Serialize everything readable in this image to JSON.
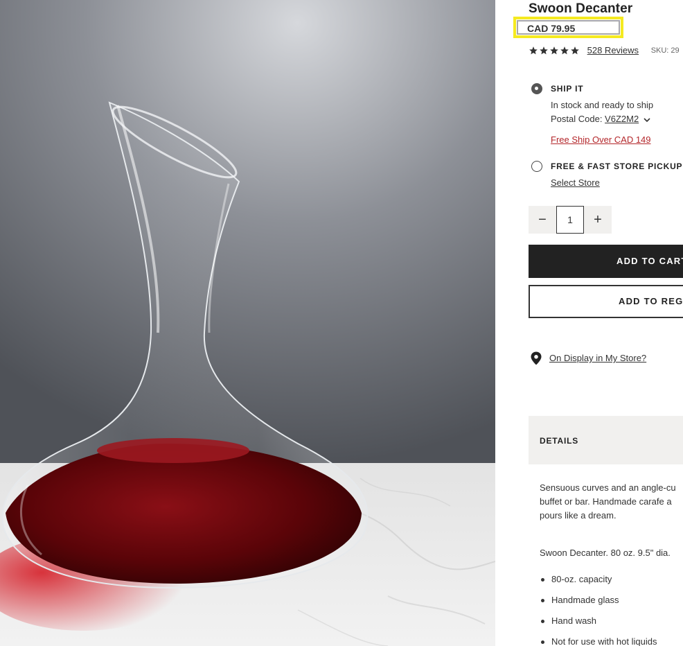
{
  "product": {
    "title": "Swoon Decanter",
    "price": "CAD 79.95",
    "rating_stars": 5,
    "reviews_link": "528 Reviews",
    "sku_label": "SKU: 29"
  },
  "fulfillment": {
    "ship_label": "SHIP IT",
    "ship_status": "In stock and ready to ship",
    "postal_prefix": "Postal Code: ",
    "postal_code": "V6Z2M2",
    "free_ship_link": "Free Ship Over CAD 149",
    "pickup_label": "FREE & FAST STORE PICKUP",
    "select_store_link": "Select Store",
    "selected_option": "ship"
  },
  "quantity": {
    "minus": "−",
    "value": "1",
    "plus": "+"
  },
  "actions": {
    "add_to_cart": "ADD TO CART",
    "add_to_registry": "ADD TO REGISTRY",
    "display_link": "On Display in My Store?"
  },
  "details": {
    "header": "DETAILS",
    "description_lines": [
      "Sensuous curves and an angle-cu",
      "buffet or bar. Handmade carafe a",
      "pours like a dream."
    ],
    "spec": "Swoon Decanter. 80 oz. 9.5\" dia.",
    "bullets": [
      "80-oz. capacity",
      "Handmade glass",
      "Hand wash",
      "Not for use with hot liquids"
    ]
  },
  "colors": {
    "highlight": "#f5ea20",
    "button_dark": "#222222",
    "red_link": "#b3262a",
    "panel_grey": "#f1f0ee"
  }
}
